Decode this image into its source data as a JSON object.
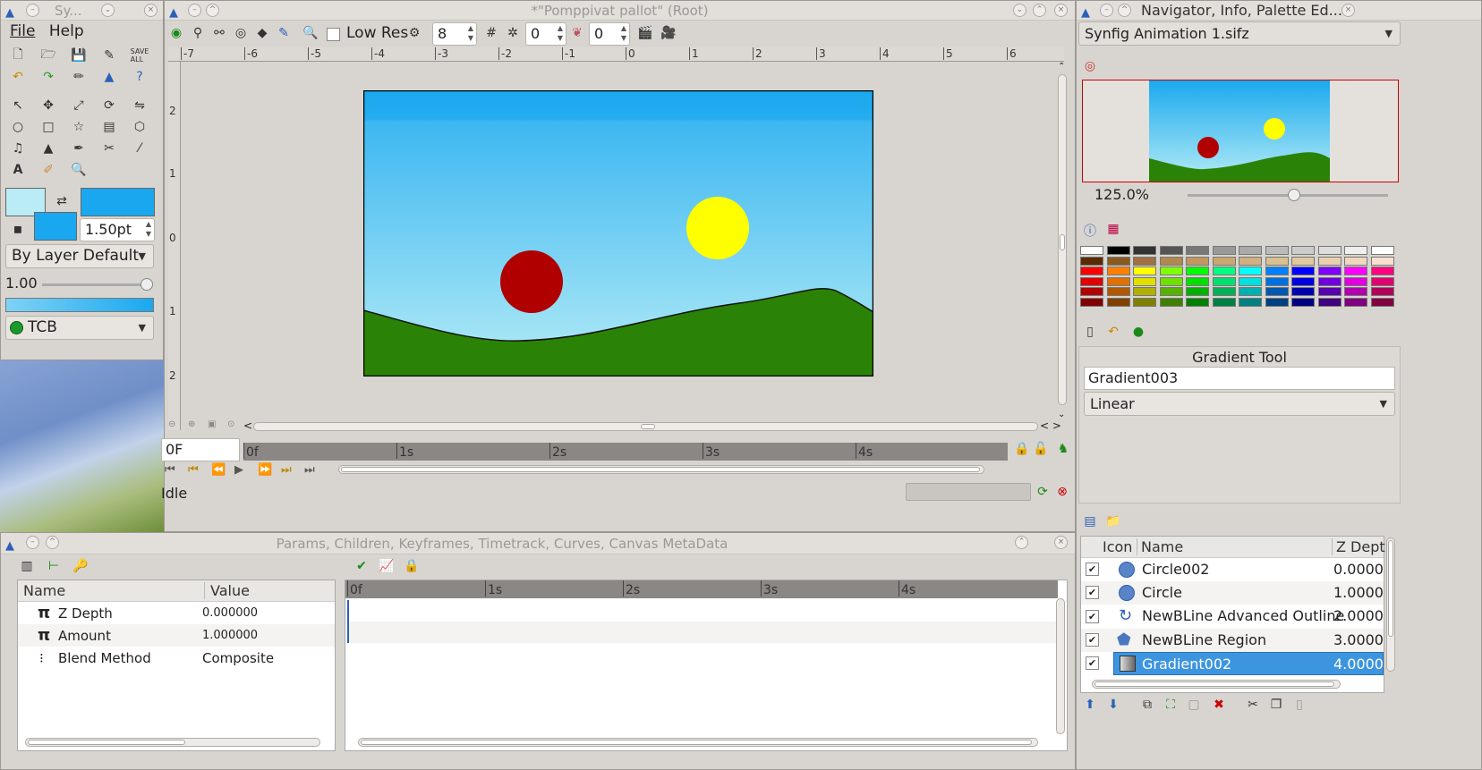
{
  "toolbox": {
    "title": "Sy...",
    "menu": [
      "File",
      "Help"
    ],
    "width_value": "1.50pt",
    "blend": "By Layer Default",
    "opacity": "1.00",
    "interp": "TCB",
    "colors": {
      "outline": "#b9ecf4",
      "fill": "#19a8f0"
    }
  },
  "canvas_window": {
    "title": "*\"Pomppivat pallot\" (Root)",
    "toolbar": {
      "low_res_label": "Low Res",
      "res_value": "8",
      "onion_a": "0",
      "onion_b": "0"
    },
    "ruler_labels": [
      "-7",
      "-6",
      "-5",
      "-4",
      "-3",
      "-2",
      "-1",
      "0",
      "1",
      "2",
      "3",
      "4",
      "5",
      "6"
    ],
    "vruler_labels": [
      "2",
      "1",
      "0",
      "1",
      "2"
    ],
    "time_field": "0F",
    "timeline_labels": [
      "0f",
      "1s",
      "2s",
      "3s",
      "4s"
    ],
    "status": "Idle"
  },
  "scene": {
    "sky_top": "#1aa9ee",
    "sky_bottom": "#b5ecf6",
    "ground": "#2a8206",
    "ball_red": "#b00000",
    "ball_yellow": "#ffff00"
  },
  "right_dock": {
    "title": "Navigator, Info, Palette Ed...",
    "file_select": "Synfig Animation 1.sifz",
    "zoom": "125.0%",
    "tool_title": "Gradient Tool",
    "tool_name": "Gradient003",
    "tool_type": "Linear"
  },
  "palette": [
    [
      "#ffffff",
      "#000000",
      "#333333",
      "#555555",
      "#777777",
      "#999999",
      "#aaaaaa",
      "#bbbbbb",
      "#cccccc",
      "#dddddd",
      "#eeeeee",
      "#ffffff"
    ],
    [
      "#5a2b00",
      "#8a5a20",
      "#a07040",
      "#b08850",
      "#c09860",
      "#c8a870",
      "#d0b080",
      "#d8c090",
      "#e0c8a0",
      "#e8d0b0",
      "#f0d8c0",
      "#f8e0d0"
    ],
    [
      "#ff0000",
      "#ff8000",
      "#ffff00",
      "#80ff00",
      "#00ff00",
      "#00ff80",
      "#00ffff",
      "#0080ff",
      "#0000ff",
      "#8000ff",
      "#ff00ff",
      "#ff0080"
    ],
    [
      "#e00000",
      "#e07000",
      "#e0e000",
      "#70e000",
      "#00e000",
      "#00e070",
      "#00e0e0",
      "#0070e0",
      "#0000e0",
      "#7000e0",
      "#e000e0",
      "#e00070"
    ],
    [
      "#b00000",
      "#b05800",
      "#b0b000",
      "#58b000",
      "#00b000",
      "#00b058",
      "#00b0b0",
      "#0058b0",
      "#0000b0",
      "#5800b0",
      "#b000b0",
      "#b00058"
    ],
    [
      "#800000",
      "#804000",
      "#808000",
      "#408000",
      "#008000",
      "#008040",
      "#008080",
      "#004080",
      "#000080",
      "#400080",
      "#800080",
      "#800040"
    ]
  ],
  "params_panel": {
    "title": "Params, Children, Keyframes, Timetrack, Curves, Canvas MetaData",
    "col_name": "Name",
    "col_value": "Value",
    "rows": [
      {
        "name": "Z Depth",
        "value": "0.000000"
      },
      {
        "name": "Amount",
        "value": "1.000000"
      },
      {
        "name": "Blend Method",
        "value": "Composite"
      }
    ],
    "timetrack_labels": [
      "0f",
      "1s",
      "2s",
      "3s",
      "4s"
    ]
  },
  "layers_panel": {
    "col_icon": "Icon",
    "col_name": "Name",
    "col_z": "Z Dept",
    "rows": [
      {
        "name": "Circle002",
        "z": "0.0000",
        "icon": "circle-icon"
      },
      {
        "name": "Circle",
        "z": "1.0000",
        "icon": "circle-icon"
      },
      {
        "name": "NewBLine Advanced Outline",
        "z": "2.0000",
        "icon": "outline-icon"
      },
      {
        "name": "NewBLine Region",
        "z": "3.0000",
        "icon": "region-icon"
      },
      {
        "name": "Gradient002",
        "z": "4.0000",
        "icon": "gradient-icon"
      }
    ]
  }
}
